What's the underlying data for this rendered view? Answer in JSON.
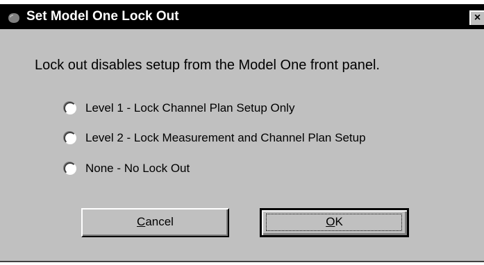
{
  "window": {
    "title": "Set Model One Lock Out",
    "close_glyph": "×"
  },
  "message": "Lock out disables setup from the Model One front panel.",
  "options": [
    {
      "label": "Level 1 - Lock Channel Plan Setup Only",
      "selected": false
    },
    {
      "label": "Level 2 - Lock Measurement and Channel Plan Setup",
      "selected": false
    },
    {
      "label": "None - No Lock Out",
      "selected": false
    }
  ],
  "buttons": {
    "cancel": {
      "mnemonic": "C",
      "rest": "ancel"
    },
    "ok": {
      "mnemonic": "O",
      "rest": "K",
      "default": true
    }
  },
  "colors": {
    "face": "#c0c0c0",
    "titlebar": "#000000",
    "title_text": "#ffffff"
  },
  "icons": {
    "title": "app-window-icon",
    "close": "close-icon"
  }
}
